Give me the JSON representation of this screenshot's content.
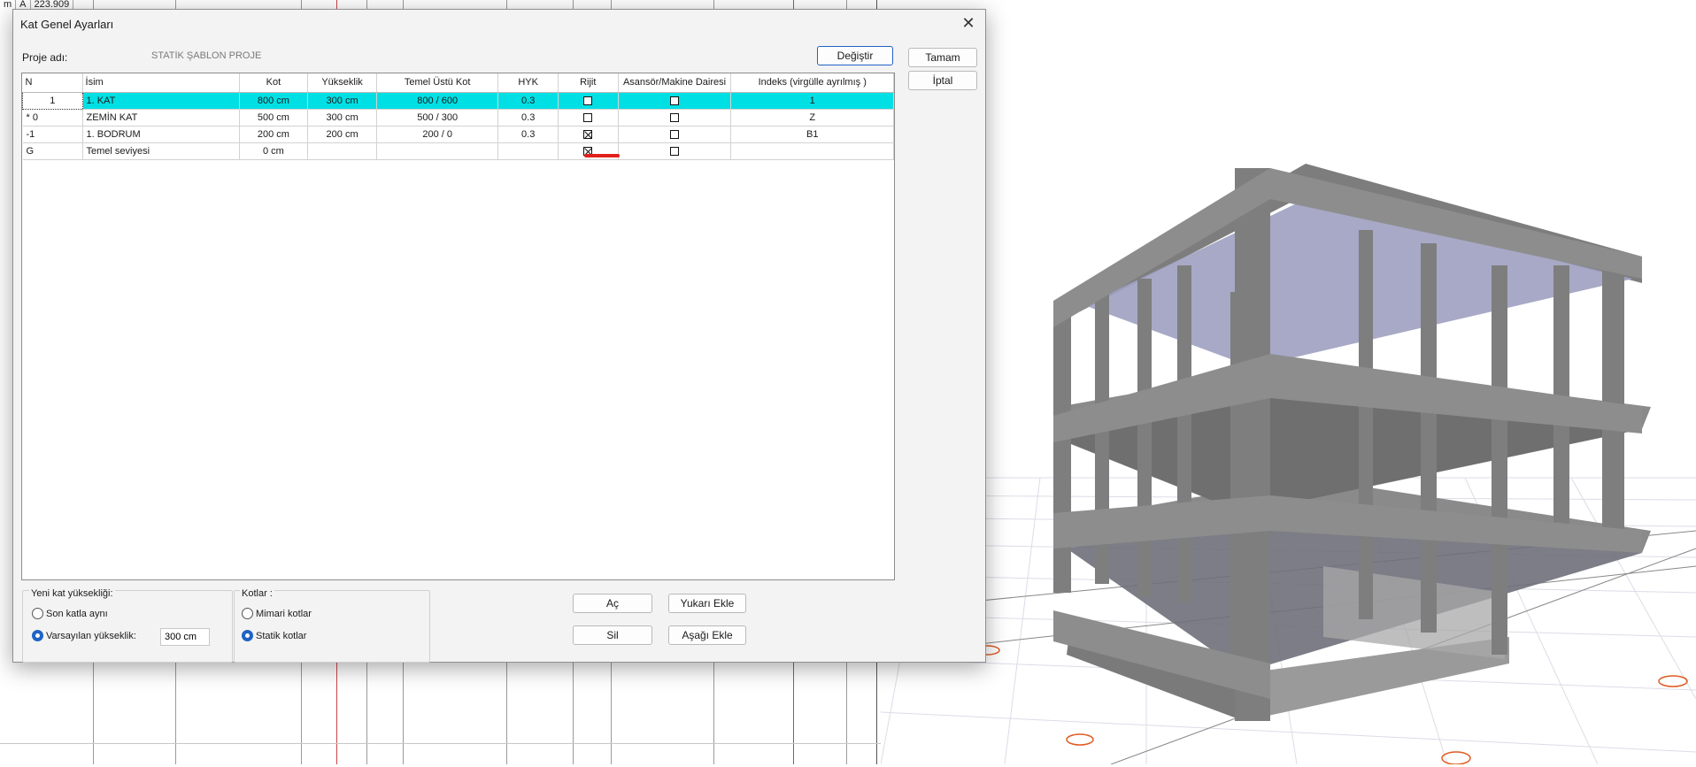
{
  "background": {
    "coord_prefix": "m",
    "coord_axis": "A",
    "coord_value": "223.909"
  },
  "dialog": {
    "title": "Kat Genel Ayarları",
    "proje_label": "Proje adı:",
    "proje_value": "STATİK ŞABLON PROJE",
    "buttons": {
      "degistir": "Değiştir",
      "tamam": "Tamam",
      "iptal": "İptal",
      "ac": "Aç",
      "yukari_ekle": "Yukarı Ekle",
      "sil": "Sil",
      "asagi_ekle": "Aşağı Ekle"
    },
    "columns": [
      "N",
      "İsim",
      "Kot",
      "Yükseklik",
      "Temel Üstü Kot",
      "HYK",
      "Rijit",
      "Asansör/Makine Dairesi",
      "Indeks (virgülle ayrılmış )"
    ],
    "rows": [
      {
        "n": "1",
        "isim": "1. KAT",
        "kot": "800 cm",
        "yukseklik": "300 cm",
        "temel": "800 / 600",
        "hyk": "0.3",
        "rijit": false,
        "asansor": false,
        "indeks": "1",
        "selected": true
      },
      {
        "n": "* 0",
        "isim": "ZEMİN KAT",
        "kot": "500 cm",
        "yukseklik": "300 cm",
        "temel": "500 / 300",
        "hyk": "0.3",
        "rijit": false,
        "asansor": false,
        "indeks": "Z",
        "selected": false
      },
      {
        "n": "-1",
        "isim": "1. BODRUM",
        "kot": "200 cm",
        "yukseklik": "200 cm",
        "temel": "200 / 0",
        "hyk": "0.3",
        "rijit": true,
        "asansor": false,
        "indeks": "B1",
        "selected": false
      },
      {
        "n": "G",
        "isim": "Temel seviyesi",
        "kot": "0 cm",
        "yukseklik": "",
        "temel": "",
        "hyk": "",
        "rijit": true,
        "asansor": false,
        "indeks": "",
        "selected": false
      }
    ],
    "yeni_kat": {
      "label": "Yeni kat yüksekliği:",
      "option1": "Son katla aynı",
      "option2": "Varsayılan yükseklik:",
      "selected": "option2",
      "height_value": "300 cm"
    },
    "kotlar": {
      "label": "Kotlar :",
      "option1": "Mimari kotlar",
      "option2": "Statik kotlar",
      "selected": "option2"
    }
  }
}
